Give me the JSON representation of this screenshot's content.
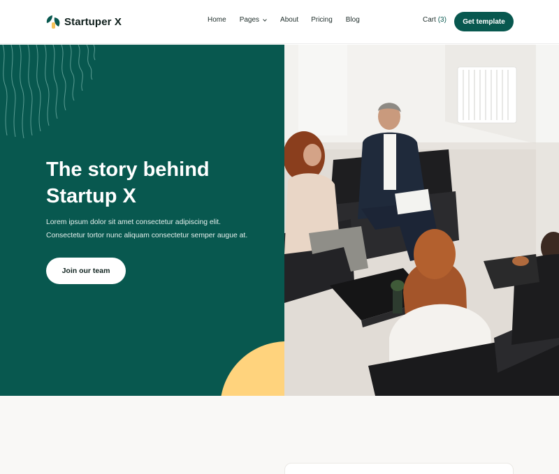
{
  "brand": {
    "name": "Startuper X",
    "colors": {
      "primary": "#08584f",
      "accent": "#ffd37d",
      "logo_leaf": "#f5c25a"
    }
  },
  "nav": {
    "items": [
      {
        "label": "Home"
      },
      {
        "label": "Pages",
        "icon": "chevron-down-icon"
      },
      {
        "label": "About"
      },
      {
        "label": "Pricing"
      },
      {
        "label": "Blog"
      }
    ],
    "cart_label": "Cart",
    "cart_count": "(3)",
    "cta_label": "Get template"
  },
  "hero": {
    "title": "The story behind Startup X",
    "text_line1": "Lorem ipsum dolor sit amet consectetur adipiscing elit.",
    "text_line2": "Consectetur tortor nunc aliquam consectetur semper augue at.",
    "button_label": "Join our team",
    "image_subject": "team-meeting-photo"
  }
}
